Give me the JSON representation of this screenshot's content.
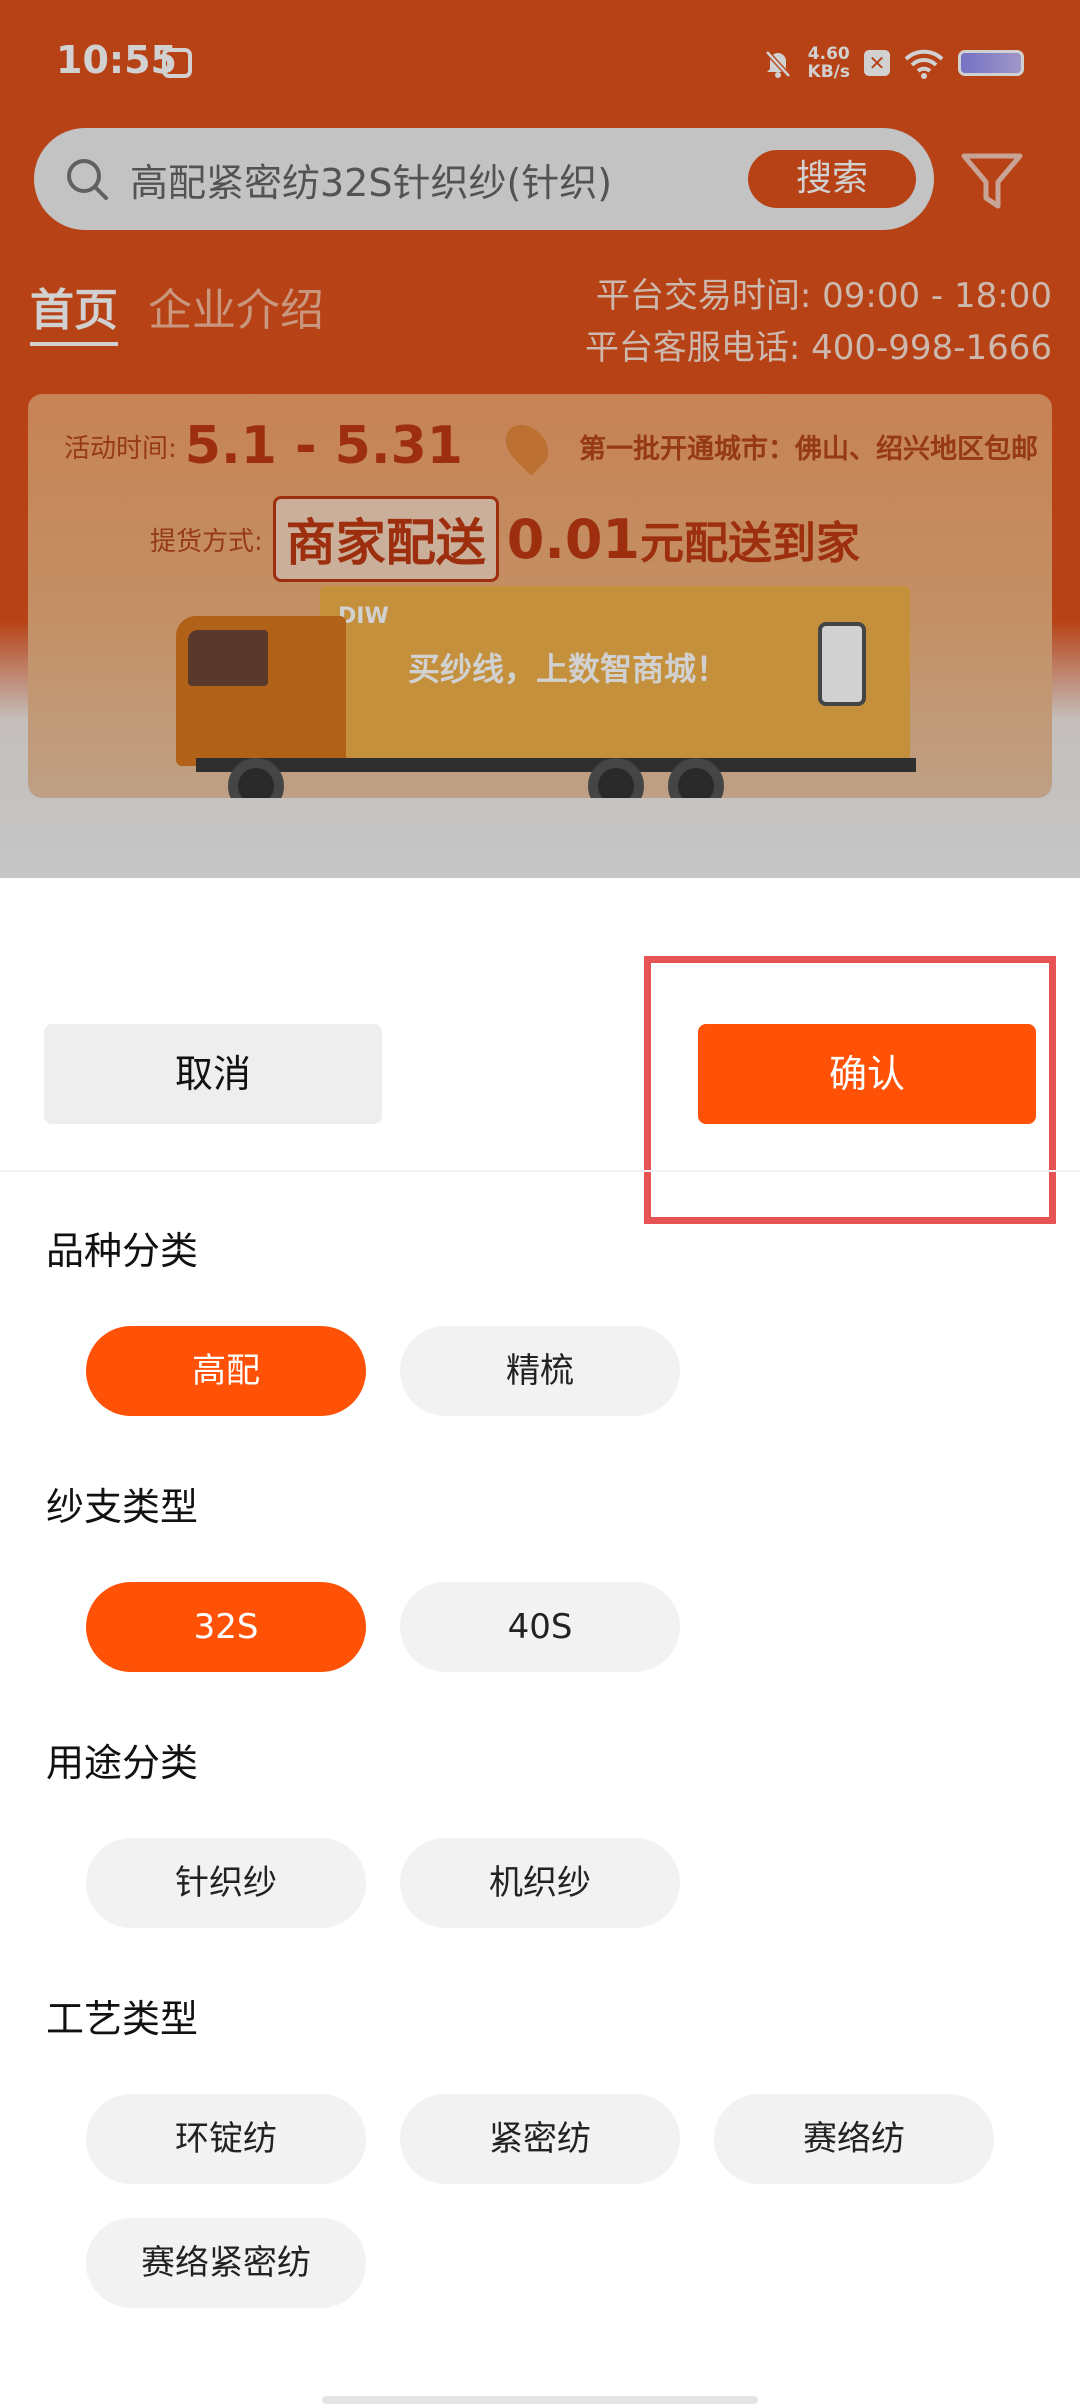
{
  "status_bar": {
    "time": "10:55",
    "speed_value": "4.60",
    "speed_unit": "KB/s"
  },
  "search": {
    "value": "高配紧密纺32S针织纱(针织)",
    "button_label": "搜索"
  },
  "tabs": [
    {
      "label": "首页",
      "active": true
    },
    {
      "label": "企业介绍",
      "active": false
    }
  ],
  "platform_info": {
    "trading_hours": "平台交易时间: 09:00 - 18:00",
    "service_phone": "平台客服电话: 400-998-1666"
  },
  "banner": {
    "activity_label": "活动时间:",
    "activity_dates": "5.1 - 5.31",
    "cities": "第一批开通城市：佛山、绍兴地区包邮",
    "pickup_label": "提货方式:",
    "pickup_method": "商家配送",
    "price": "0.01",
    "price_suffix": "元配送到家",
    "truck_logo": "DIW",
    "truck_slogan": "买纱线，上数智商城！"
  },
  "sheet": {
    "cancel_label": "取消",
    "confirm_label": "确认",
    "sections": [
      {
        "title": "品种分类",
        "options": [
          {
            "label": "高配",
            "selected": true
          },
          {
            "label": "精梳",
            "selected": false
          }
        ]
      },
      {
        "title": "纱支类型",
        "options": [
          {
            "label": "32S",
            "selected": true
          },
          {
            "label": "40S",
            "selected": false
          }
        ]
      },
      {
        "title": "用途分类",
        "options": [
          {
            "label": "针织纱",
            "selected": false
          },
          {
            "label": "机织纱",
            "selected": false
          }
        ]
      },
      {
        "title": "工艺类型",
        "options": [
          {
            "label": "环锭纺",
            "selected": false
          },
          {
            "label": "紧密纺",
            "selected": false
          },
          {
            "label": "赛络纺",
            "selected": false
          },
          {
            "label": "赛络紧密纺",
            "selected": false
          }
        ]
      }
    ]
  },
  "colors": {
    "accent": "#ff5206",
    "highlight_box": "#e65355",
    "chip_bg": "#f2f2f2"
  }
}
